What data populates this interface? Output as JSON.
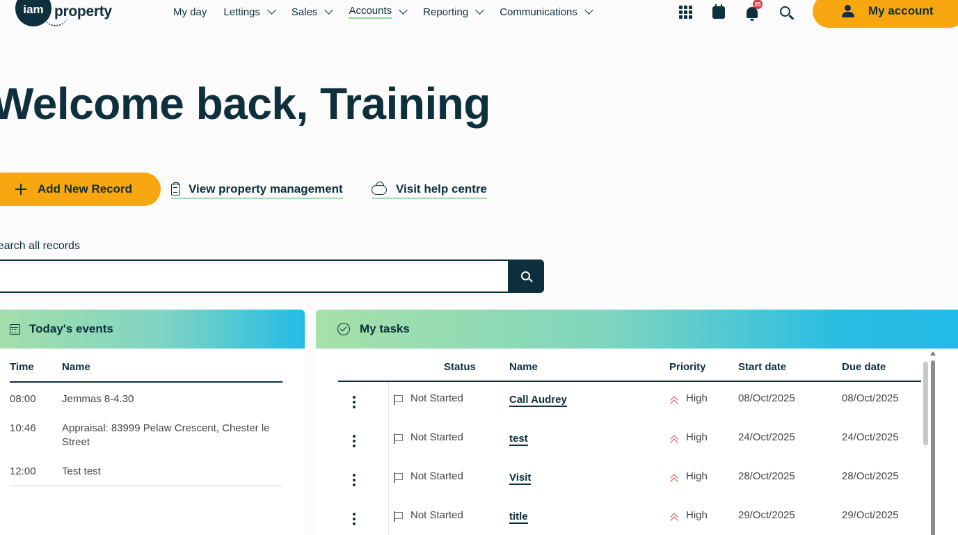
{
  "brand": {
    "logo_mark": "iam",
    "logo_text": "property"
  },
  "nav": [
    {
      "label": "My day",
      "dropdown": false,
      "active": false
    },
    {
      "label": "Lettings",
      "dropdown": true,
      "active": false
    },
    {
      "label": "Sales",
      "dropdown": true,
      "active": false
    },
    {
      "label": "Accounts",
      "dropdown": true,
      "active": true
    },
    {
      "label": "Reporting",
      "dropdown": true,
      "active": false
    },
    {
      "label": "Communications",
      "dropdown": true,
      "active": false
    }
  ],
  "header_icons": {
    "apps": "apps-grid-icon",
    "calendar": "calendar-icon",
    "notifications": "bell-icon",
    "notification_count": "25",
    "search": "search-icon"
  },
  "account": {
    "label": "My account",
    "icon": "user-icon"
  },
  "welcome": "Welcome back, Training",
  "actions": {
    "add_label": "Add New Record",
    "view_pm_label": "View property management",
    "help_label": "Visit help centre"
  },
  "search": {
    "label": "Search all records",
    "placeholder": "",
    "value": ""
  },
  "events": {
    "title": "Today's events",
    "columns": [
      "Time",
      "Name"
    ],
    "rows": [
      {
        "time": "08:00",
        "name": "Jemmas 8-4.30"
      },
      {
        "time": "10:46",
        "name": "Appraisal: 83999 Pelaw Crescent, Chester le Street"
      },
      {
        "time": "12:00",
        "name": "Test test"
      }
    ]
  },
  "tasks": {
    "title": "My tasks",
    "columns": {
      "status": "Status",
      "name": "Name",
      "priority": "Priority",
      "start": "Start date",
      "due": "Due date"
    },
    "rows": [
      {
        "status": "Not Started",
        "name": "Call Audrey",
        "priority": "High",
        "start": "08/Oct/2025",
        "due": "08/Oct/2025"
      },
      {
        "status": "Not Started",
        "name": "test",
        "priority": "High",
        "start": "24/Oct/2025",
        "due": "24/Oct/2025"
      },
      {
        "status": "Not Started",
        "name": "Visit",
        "priority": "High",
        "start": "28/Oct/2025",
        "due": "28/Oct/2025"
      },
      {
        "status": "Not Started",
        "name": "title",
        "priority": "High",
        "start": "29/Oct/2025",
        "due": "29/Oct/2025"
      }
    ]
  },
  "colors": {
    "primary": "#0e2f3c",
    "accent": "#f9a711",
    "priority_high": "#d0443e",
    "badge": "#d63c4a"
  }
}
